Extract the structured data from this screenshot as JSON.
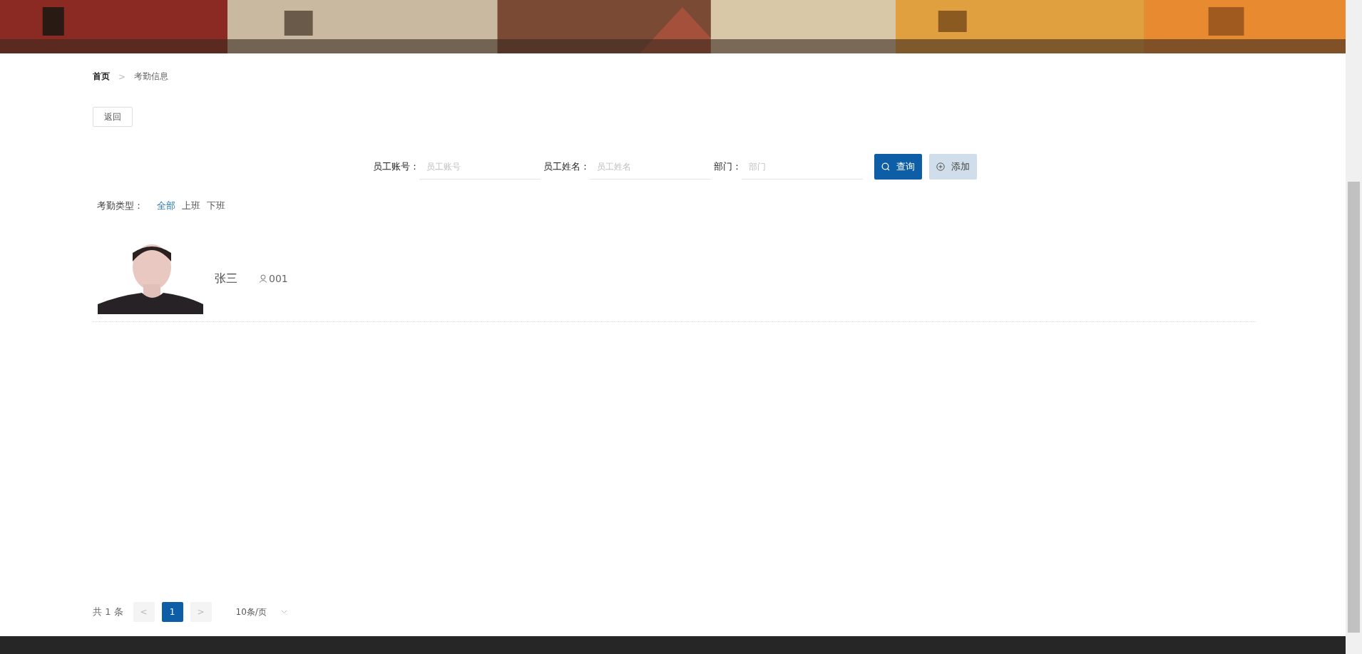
{
  "breadcrumb": [
    {
      "label": "首页",
      "current": false
    },
    {
      "label": "考勤信息",
      "current": true
    }
  ],
  "breadcrumb_separator": ">",
  "back_button": "返回",
  "search": {
    "fields": [
      {
        "label": "员工账号：",
        "placeholder": "员工账号"
      },
      {
        "label": "员工姓名：",
        "placeholder": "员工姓名"
      },
      {
        "label": "部门：",
        "placeholder": "部门"
      }
    ],
    "query_button": "查询",
    "add_button": "添加"
  },
  "filter": {
    "label": "考勤类型：",
    "options": [
      {
        "label": "全部",
        "selected": true
      },
      {
        "label": "上班",
        "selected": false
      },
      {
        "label": "下班",
        "selected": false
      }
    ]
  },
  "records": [
    {
      "name": "张三",
      "account": "001"
    }
  ],
  "pagination": {
    "total": "共 1 条",
    "prev": "<",
    "pages": [
      {
        "label": "1",
        "selected": true
      }
    ],
    "next": ">",
    "page_size": "10条/页"
  }
}
